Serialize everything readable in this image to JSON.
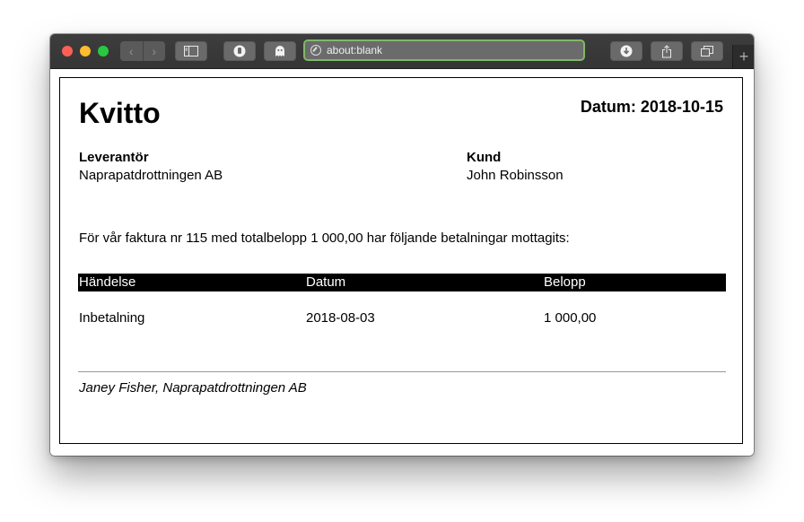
{
  "browser": {
    "url": "about:blank",
    "new_tab_label": "+"
  },
  "receipt": {
    "title": "Kvitto",
    "date": "Datum: 2018-10-15",
    "supplier_label": "Leverantör",
    "supplier_name": "Naprapatdrottningen AB",
    "customer_label": "Kund",
    "customer_name": "John Robinsson",
    "intro": "För vår faktura nr 115 med totalbelopp 1 000,00 har följande betalningar mottagits:",
    "table": {
      "headers": [
        "Händelse",
        "Datum",
        "Belopp"
      ],
      "rows": [
        [
          "Inbetalning",
          "2018-08-03",
          "1 000,00"
        ]
      ]
    },
    "signature": "Janey Fisher, Naprapatdrottningen AB"
  }
}
